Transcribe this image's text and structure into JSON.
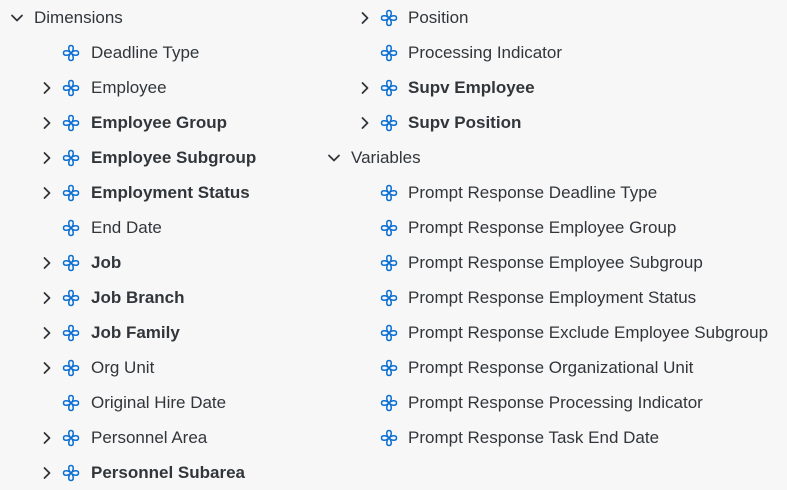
{
  "tree": {
    "dimensions": {
      "label": "Dimensions",
      "expanded": true,
      "items": [
        {
          "label": "Deadline Type",
          "bold": false,
          "expandable": false
        },
        {
          "label": "Employee",
          "bold": false,
          "expandable": true
        },
        {
          "label": "Employee Group",
          "bold": true,
          "expandable": true
        },
        {
          "label": "Employee Subgroup",
          "bold": true,
          "expandable": true
        },
        {
          "label": "Employment Status",
          "bold": true,
          "expandable": true
        },
        {
          "label": "End Date",
          "bold": false,
          "expandable": false
        },
        {
          "label": "Job",
          "bold": true,
          "expandable": true
        },
        {
          "label": "Job Branch",
          "bold": true,
          "expandable": true
        },
        {
          "label": "Job Family",
          "bold": true,
          "expandable": true
        },
        {
          "label": "Org Unit",
          "bold": false,
          "expandable": true
        },
        {
          "label": "Original Hire Date",
          "bold": false,
          "expandable": false
        },
        {
          "label": "Personnel Area",
          "bold": false,
          "expandable": true
        },
        {
          "label": "Personnel Subarea",
          "bold": true,
          "expandable": true
        },
        {
          "label": "Position",
          "bold": false,
          "expandable": true
        },
        {
          "label": "Processing Indicator",
          "bold": false,
          "expandable": false
        },
        {
          "label": "Supv Employee",
          "bold": true,
          "expandable": true
        },
        {
          "label": "Supv Position",
          "bold": true,
          "expandable": true
        }
      ]
    },
    "variables": {
      "label": "Variables",
      "expanded": true,
      "items": [
        {
          "label": "Prompt Response Deadline Type"
        },
        {
          "label": "Prompt Response Employee Group"
        },
        {
          "label": "Prompt Response Employee Subgroup"
        },
        {
          "label": "Prompt Response Employment Status"
        },
        {
          "label": "Prompt Response Exclude Employee Subgroup"
        },
        {
          "label": "Prompt Response Organizational Unit"
        },
        {
          "label": "Prompt Response Processing Indicator"
        },
        {
          "label": "Prompt Response Task End Date"
        }
      ]
    }
  },
  "colors": {
    "text": "#32363a",
    "chevron": "#32363a",
    "icon": "#0a6ed1",
    "background": "#f7f7f7"
  },
  "icons": {
    "expand": "chevron-right-icon",
    "collapse": "chevron-down-icon",
    "dimension": "dimension-icon"
  }
}
